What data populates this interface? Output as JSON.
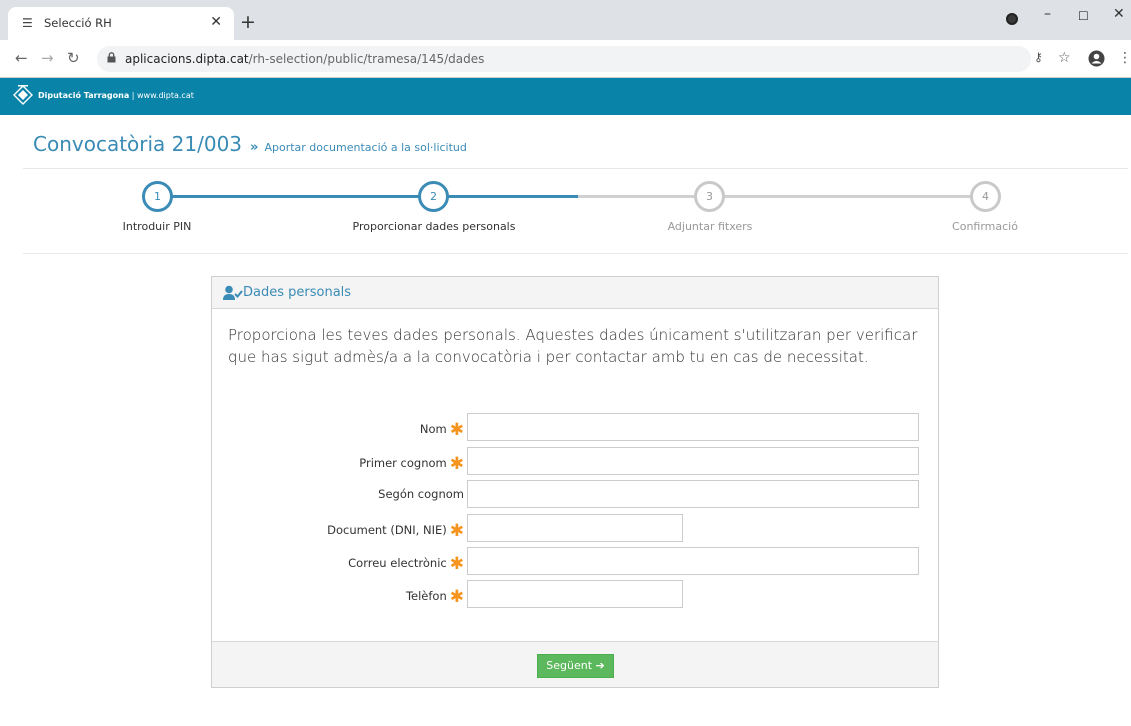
{
  "browser": {
    "tab_title": "Selecció RH",
    "url_host": "aplicacions.dipta.cat",
    "url_path": "/rh-selection/public/tramesa/145/dades"
  },
  "banner": {
    "brand": "Diputació Tarragona",
    "site": " | www.dipta.cat"
  },
  "heading": {
    "title": "Convocatòria 21/003",
    "separator": "»",
    "subtitle": "Aportar documentació a la sol·licitud"
  },
  "stepper": {
    "steps": [
      {
        "number": "1",
        "label": "Introduir PIN",
        "state": "active"
      },
      {
        "number": "2",
        "label": "Proporcionar dades personals",
        "state": "active"
      },
      {
        "number": "3",
        "label": "Adjuntar fitxers",
        "state": "inactive"
      },
      {
        "number": "4",
        "label": "Confirmació",
        "state": "inactive"
      }
    ]
  },
  "panel": {
    "title": "Dades personals",
    "intro": "Proporciona les teves dades personals. Aquestes dades únicament s'utilitzaran per verificar que has sigut admès/a a la convocatòria i per contactar amb tu en cas de necessitat.",
    "fields": [
      {
        "label": "Nom",
        "required": true,
        "value": ""
      },
      {
        "label": "Primer cognom",
        "required": true,
        "value": ""
      },
      {
        "label": "Segón cognom",
        "required": false,
        "value": ""
      },
      {
        "label": "Document (DNI, NIE)",
        "required": true,
        "value": ""
      },
      {
        "label": "Correu electrònic",
        "required": true,
        "value": ""
      },
      {
        "label": "Telèfon",
        "required": true,
        "value": ""
      }
    ],
    "required_marker": "✱",
    "next_label": "Següent",
    "next_arrow": "➔"
  },
  "colors": {
    "accent": "#3a8bb5",
    "banner": "#0a83a8",
    "required": "#f7941d",
    "button": "#5cb85c"
  }
}
